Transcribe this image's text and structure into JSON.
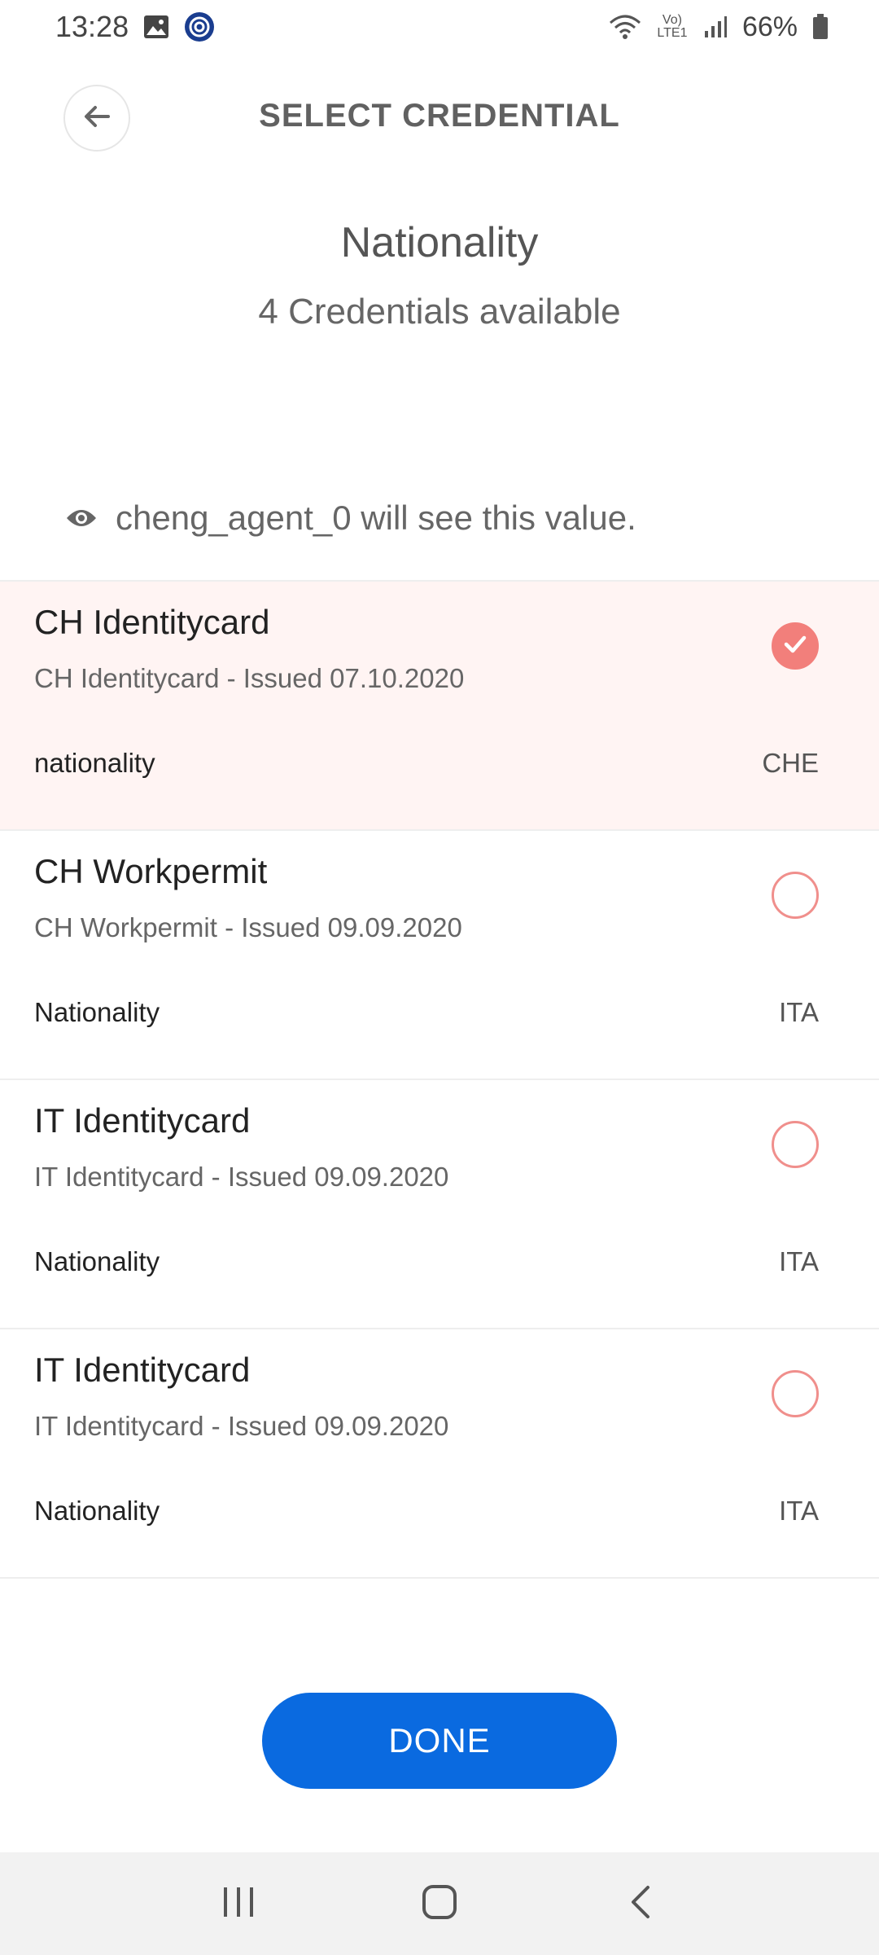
{
  "status_bar": {
    "time": "13:28",
    "network_label": "Vo) LTE1",
    "battery": "66%",
    "icons": [
      "gallery-icon",
      "app-notification-icon",
      "wifi-icon",
      "volte-icon",
      "signal-icon",
      "battery-icon"
    ]
  },
  "header": {
    "title": "SELECT CREDENTIAL",
    "back_icon": "arrow-left-icon"
  },
  "attribute": {
    "name": "Nationality",
    "count_text": "4 Credentials available"
  },
  "visibility": {
    "icon": "eye-icon",
    "text": "cheng_agent_0 will see this value."
  },
  "credentials": [
    {
      "title": "CH Identitycard",
      "subtitle": "CH Identitycard - Issued 07.10.2020",
      "attr_label": "nationality",
      "attr_value": "CHE",
      "selected": true
    },
    {
      "title": "CH Workpermit",
      "subtitle": "CH Workpermit - Issued 09.09.2020",
      "attr_label": "Nationality",
      "attr_value": "ITA",
      "selected": false
    },
    {
      "title": "IT Identitycard",
      "subtitle": "IT Identitycard - Issued 09.09.2020",
      "attr_label": "Nationality",
      "attr_value": "ITA",
      "selected": false
    },
    {
      "title": "IT Identitycard",
      "subtitle": "IT Identitycard - Issued 09.09.2020",
      "attr_label": "Nationality",
      "attr_value": "ITA",
      "selected": false
    }
  ],
  "done_button": {
    "label": "DONE"
  },
  "colors": {
    "accent": "#0a6ae0",
    "selected_bg": "#fff4f3",
    "radio": "#f27f7b"
  },
  "nav_bar": {
    "icons": [
      "recent-apps-icon",
      "home-icon",
      "back-icon"
    ]
  }
}
